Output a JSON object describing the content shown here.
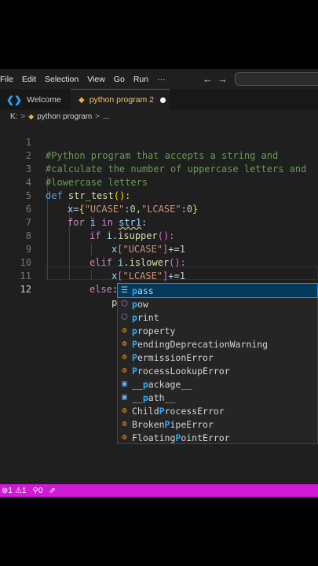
{
  "menubar": {
    "items": [
      "File",
      "Edit",
      "Selection",
      "View",
      "Go",
      "Run",
      "···"
    ],
    "back_arrow": "←",
    "forward_arrow": "→"
  },
  "tabs": [
    {
      "label": "Welcome",
      "icon": "vscode-icon"
    },
    {
      "label": "python program 2",
      "icon": "python-file-icon",
      "active": true,
      "dirty": true
    }
  ],
  "breadcrumb": {
    "drive": "K:",
    "sep": ">",
    "file": "python program",
    "tail": "..."
  },
  "editor": {
    "line_numbers": [
      "1",
      "2",
      "3",
      "4",
      "5",
      "6",
      "7",
      "8",
      "9",
      "10",
      "11",
      "12"
    ],
    "current_line": 12,
    "lines": {
      "l1": "#Python program that accepts a string and",
      "l2": "#calculate the number of uppercase letters and",
      "l3": "#lowercase letters",
      "l4_def": "def",
      "l4_fn": "str_test",
      "l4_rest": "():",
      "l5_var": "x",
      "l5_eq": "=",
      "l5_open": "{",
      "l5_s1": "\"UCASE\"",
      "l5_c1": ":",
      "l5_n1": "0",
      "l5_comma": ",",
      "l5_s2": "\"LCASE\"",
      "l5_c2": ":",
      "l5_n2": "0",
      "l5_close": "}",
      "l6_for": "for",
      "l6_i": "i",
      "l6_in": "in",
      "l6_str": "str1",
      "l6_colon": ":",
      "l7_if": "if",
      "l7_i": "i.",
      "l7_fn": "isupper",
      "l7_rest": "():",
      "l8_x": "x",
      "l8_open": "[",
      "l8_s": "\"UCASE\"",
      "l8_close": "]",
      "l8_op": "+=",
      "l8_n": "1",
      "l9_elif": "elif",
      "l9_i": "i.",
      "l9_fn": "islower",
      "l9_rest": "():",
      "l10_x": "x",
      "l10_open": "[",
      "l10_s": "\"LCASE\"",
      "l10_close": "]",
      "l10_op": "+=",
      "l10_n": "1",
      "l11_else": "else",
      "l11_colon": ":",
      "l12_typed": "p"
    }
  },
  "suggestions": [
    {
      "label": "pass",
      "match": "p",
      "rest": "ass",
      "kind": "keyword-icon",
      "selected": true
    },
    {
      "label": "pow",
      "match": "p",
      "rest": "ow",
      "kind": "function-icon"
    },
    {
      "label": "print",
      "match": "p",
      "rest": "rint",
      "kind": "function-icon"
    },
    {
      "label": "property",
      "match": "p",
      "rest": "roperty",
      "kind": "class-icon"
    },
    {
      "label": "PendingDeprecationWarning",
      "pre": "",
      "match": "P",
      "rest": "endingDeprecationWarning",
      "kind": "class-icon"
    },
    {
      "label": "PermissionError",
      "pre": "",
      "match": "P",
      "rest": "ermissionError",
      "kind": "class-icon"
    },
    {
      "label": "ProcessLookupError",
      "pre": "",
      "match": "P",
      "rest": "rocessLookupError",
      "kind": "class-icon"
    },
    {
      "label": "__package__",
      "pre": "__",
      "match": "p",
      "rest": "ackage__",
      "kind": "variable-icon"
    },
    {
      "label": "__path__",
      "pre": "__",
      "match": "p",
      "rest": "ath__",
      "kind": "variable-icon"
    },
    {
      "label": "ChildProcessError",
      "pre": "Child",
      "match": "P",
      "rest": "rocessError",
      "kind": "class-icon"
    },
    {
      "label": "BrokenPipeError",
      "pre": "Broken",
      "match": "P",
      "rest": "ipeError",
      "kind": "class-icon"
    },
    {
      "label": "FloatingPointError",
      "pre": "Floating",
      "match": "P",
      "rest": "ointError",
      "kind": "class-icon"
    }
  ],
  "statusbar": {
    "errors": "1",
    "warnings": "1",
    "ports": "0",
    "accent": "#d11ad6"
  }
}
